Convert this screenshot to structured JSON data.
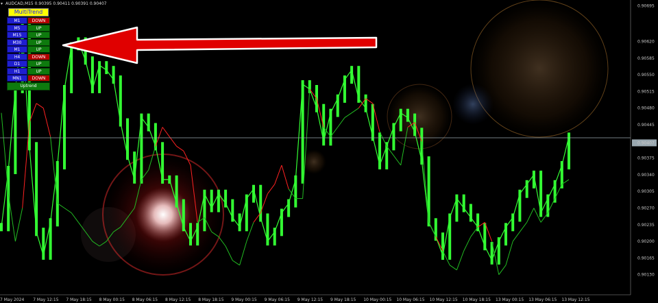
{
  "header": {
    "symbol_line": "AUDCAD,M15  0.90395 0.90411 0.90391 0.90407"
  },
  "panel": {
    "title": "MultiTrend",
    "rows": [
      {
        "tf": "M1",
        "dir": "DOWN"
      },
      {
        "tf": "M5",
        "dir": "UP"
      },
      {
        "tf": "M15",
        "dir": "UP"
      },
      {
        "tf": "M30",
        "dir": "UP"
      },
      {
        "tf": "M1",
        "dir": "UP"
      },
      {
        "tf": "H4",
        "dir": "DOWN"
      },
      {
        "tf": "D1",
        "dir": "UP"
      },
      {
        "tf": "H1",
        "dir": "UP"
      },
      {
        "tf": "MN1",
        "dir": "DOWN"
      }
    ],
    "summary": "Uptrend"
  },
  "colors": {
    "background": "#000000",
    "candle": "#33ff33",
    "trend_line_up": "#22bb22",
    "trend_line_down": "#ff2222",
    "panel_up": "#0e7a0e",
    "panel_down": "#b40000",
    "panel_tf": "#1f1fd0",
    "panel_title_bg": "#ffff00",
    "arrow": "#ee0000",
    "current_price_line": "#9aa8b0"
  },
  "chart_data": {
    "type": "line",
    "symbol": "AUDCAD",
    "timeframe": "M15",
    "current_price": 0.90407,
    "price_labels": [
      "0.90695",
      "0.90620",
      "0.90585",
      "0.90550",
      "0.90515",
      "0.90480",
      "0.90445",
      "0.90407",
      "0.90375",
      "0.90340",
      "0.90305",
      "0.90270",
      "0.90235",
      "0.90200",
      "0.90165",
      "0.90130"
    ],
    "time_labels": [
      "7 May 2024",
      "7 May 12:15",
      "7 May 18:15",
      "8 May 00:15",
      "8 May 06:15",
      "8 May 12:15",
      "8 May 18:15",
      "9 May 00:15",
      "9 May 06:15",
      "9 May 12:15",
      "9 May 18:15",
      "10 May 00:15",
      "10 May 06:15",
      "10 May 12:15",
      "10 May 18:15",
      "13 May 00:15",
      "13 May 06:15",
      "13 May 12:15"
    ],
    "ylim": [
      0.90095,
      0.907
    ],
    "series": [
      {
        "values": [
          0.9023,
          0.9035,
          0.9052,
          0.9065,
          0.904,
          0.9022,
          0.9017,
          0.9024,
          0.9036,
          0.9052,
          0.9061,
          0.9062,
          0.9058,
          0.9052,
          0.9057,
          0.9056,
          0.9054,
          0.9045,
          0.9038,
          0.9033,
          0.9046,
          0.9044,
          0.904,
          0.9033,
          0.9033,
          0.9028,
          0.9023,
          0.902,
          0.9023,
          0.903,
          0.9027,
          0.903,
          0.9028,
          0.9025,
          0.9023,
          0.9029,
          0.9031,
          0.9025,
          0.902,
          0.9022,
          0.9026,
          0.9028,
          0.9033,
          0.9053,
          0.9052,
          0.9048,
          0.9041,
          0.9047,
          0.905,
          0.9054,
          0.9056,
          0.905,
          0.9048,
          0.9042,
          0.9036,
          0.904,
          0.9044,
          0.9047,
          0.9046,
          0.9043,
          0.9037,
          0.9024,
          0.9021,
          0.9017,
          0.9025,
          0.9029,
          0.9027,
          0.9025,
          0.9023,
          0.9019,
          0.9016,
          0.902,
          0.9023,
          0.9025,
          0.903,
          0.9032,
          0.9034,
          0.9026,
          0.9029,
          0.9032,
          0.9036,
          0.9042
        ]
      },
      {
        "values": [
          0.9047,
          0.903,
          0.902,
          0.9027,
          0.9045,
          0.9049,
          0.9048,
          0.9042,
          0.9028,
          0.9027,
          0.9026,
          0.9024,
          0.9022,
          0.902,
          0.9019,
          0.902,
          0.9022,
          0.9023,
          0.9025,
          0.9027,
          0.9033,
          0.9035,
          0.904,
          0.9044,
          0.9042,
          0.904,
          0.9039,
          0.9036,
          0.9024,
          0.9025,
          0.9022,
          0.9021,
          0.9019,
          0.9016,
          0.9015,
          0.902,
          0.9024,
          0.9026,
          0.903,
          0.9032,
          0.9036,
          0.9031,
          0.9029,
          0.9029,
          0.9052,
          0.905,
          0.9044,
          0.9042,
          0.9044,
          0.9046,
          0.9047,
          0.9048,
          0.905,
          0.9049,
          0.9043,
          0.904,
          0.9038,
          0.9036,
          0.9044,
          0.9045,
          0.9041,
          0.9024,
          0.9021,
          0.9018,
          0.9015,
          0.9014,
          0.9018,
          0.9021,
          0.9023,
          0.9024,
          0.902,
          0.9013,
          0.9015,
          0.902,
          0.9022,
          0.9024,
          0.9027,
          0.9024,
          0.9026,
          0.9029,
          0.9032,
          0.9033
        ]
      }
    ]
  }
}
